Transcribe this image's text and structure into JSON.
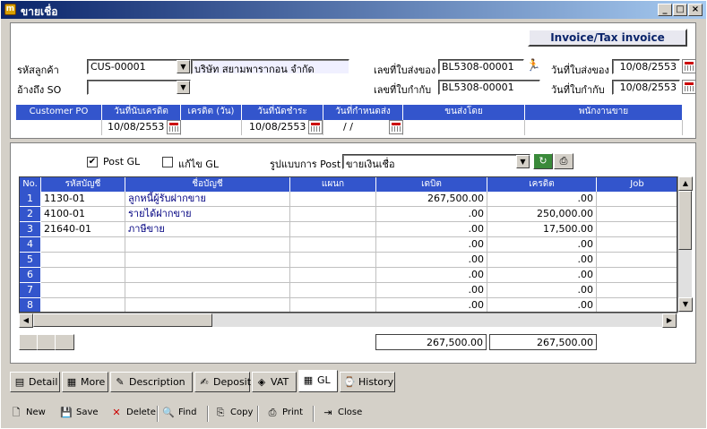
{
  "window": {
    "title": "ขายเชื่อ",
    "min": "_",
    "max": "□",
    "close": "×"
  },
  "doc_type": "Invoice/Tax invoice",
  "form": {
    "customer_code_label": "รหัสลูกค้า",
    "customer_code": "CUS-00001",
    "customer_name": "บริษัท สยามพารากอน จำกัด",
    "so_ref_label": "อ้างถึง SO",
    "so_ref": "",
    "delivery_no_label": "เลขที่ใบส่งของ",
    "delivery_no": "BL5308-00001",
    "tax_no_label": "เลขที่ใบกำกับ",
    "tax_no": "BL5308-00001",
    "delivery_date_label": "วันที่ใบส่งของ",
    "delivery_date": "10/08/2553",
    "tax_date_label": "วันที่ใบกำกับ",
    "tax_date": "10/08/2553"
  },
  "info_headers": [
    "Customer PO",
    "วันที่นับเครดิต",
    "เครดิต (วัน)",
    "วันที่นัดชำระ",
    "วันที่กำหนดส่ง",
    "ขนส่งโดย",
    "พนักงานขาย"
  ],
  "info_values": {
    "credit_start": "10/08/2553",
    "due_date": "10/08/2553",
    "ship_date": " / /"
  },
  "gl": {
    "post_gl_label": "Post GL",
    "post_gl_checked": "✔",
    "edit_gl_label": "แก้ไข GL",
    "format_label": "รูปแบบการ Post",
    "format_value": "ขายเงินเชื่อ"
  },
  "grid": {
    "headers": [
      "No.",
      "รหัสบัญชี",
      "ชื่อบัญชี",
      "แผนก",
      "เดบิต",
      "เครดิต",
      "Job"
    ],
    "rows": [
      {
        "no": "1",
        "code": "1130-01",
        "name": "ลูกหนี้ผู้รับฝากขาย",
        "dept": "",
        "debit": "267,500.00",
        "credit": ".00"
      },
      {
        "no": "2",
        "code": "4100-01",
        "name": "รายได้ฝากขาย",
        "dept": "",
        "debit": ".00",
        "credit": "250,000.00"
      },
      {
        "no": "3",
        "code": "21640-01",
        "name": "ภาษีขาย",
        "dept": "",
        "debit": ".00",
        "credit": "17,500.00"
      },
      {
        "no": "4",
        "code": "",
        "name": "",
        "dept": "",
        "debit": ".00",
        "credit": ".00"
      },
      {
        "no": "5",
        "code": "",
        "name": "",
        "dept": "",
        "debit": ".00",
        "credit": ".00"
      },
      {
        "no": "6",
        "code": "",
        "name": "",
        "dept": "",
        "debit": ".00",
        "credit": ".00"
      },
      {
        "no": "7",
        "code": "",
        "name": "",
        "dept": "",
        "debit": ".00",
        "credit": ".00"
      },
      {
        "no": "8",
        "code": "",
        "name": "",
        "dept": "",
        "debit": ".00",
        "credit": ".00"
      }
    ],
    "total_debit": "267,500.00",
    "total_credit": "267,500.00"
  },
  "tabs": [
    "Detail",
    "More",
    "Description",
    "Deposit",
    "VAT",
    "GL",
    "History"
  ],
  "toolbar": [
    "New",
    "Save",
    "Delete",
    "Find",
    "Copy",
    "Print",
    "Close"
  ]
}
